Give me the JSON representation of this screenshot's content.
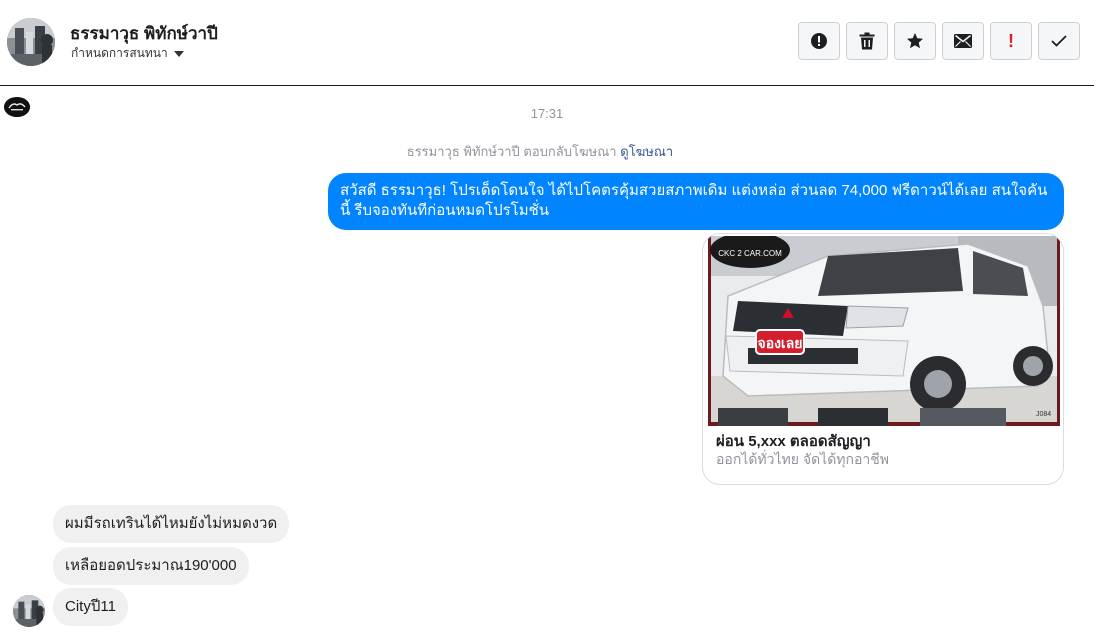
{
  "header": {
    "contact_name": "ธรรมาวุธ พิทักษ์วาปี",
    "assign_label": "กำหนดการสนทนา",
    "colors": {
      "divider": "#1c1c1c",
      "button_border": "#ccd0d5",
      "alert_red": "#e02020"
    },
    "toolbar": [
      {
        "name": "report-button",
        "icon": "alert-circle-icon"
      },
      {
        "name": "delete-button",
        "icon": "trash-icon"
      },
      {
        "name": "star-button",
        "icon": "star-icon"
      },
      {
        "name": "mail-button",
        "icon": "envelope-icon"
      },
      {
        "name": "important-button",
        "icon": "exclamation-icon",
        "label": "!"
      },
      {
        "name": "done-button",
        "icon": "checkmark-icon"
      }
    ]
  },
  "thread": {
    "timestamp": "17:31",
    "reply_note": {
      "text": "ธรรมาวุธ พิทักษ์วาปี ตอบกลับโฆษณา",
      "link": "ดูโฆษณา"
    },
    "outgoing_message": "สวัสดี ธรรมาวุธ! โปรเด็ดโดนใจ ได้ไปโคตรคุ้มสวยสภาพเดิม แต่งหล่อ  ส่วนลด 74,000 ฟรีดาวน์ได้เลย  สนใจคันนี้ รีบจองทันทีก่อนหมดโปรโมชั่น",
    "outgoing_color": "#0084ff",
    "ad_card": {
      "image_watermark": "CKC 2 CAR.COM",
      "image_badge": "จองเลย",
      "image_code": "J084",
      "title": "ผ่อน 5,xxx ตลอดสัญญา",
      "description": "ออกได้ทั่วไทย จัดได้ทุกอาชีพ"
    },
    "incoming_messages": [
      "ผมมีรถเทรินได้ไหมยังไม่หมดงวด",
      "เหลือยอดประมาณ190'000",
      "Cityปี11"
    ],
    "incoming_color": "#f1f0f0"
  }
}
